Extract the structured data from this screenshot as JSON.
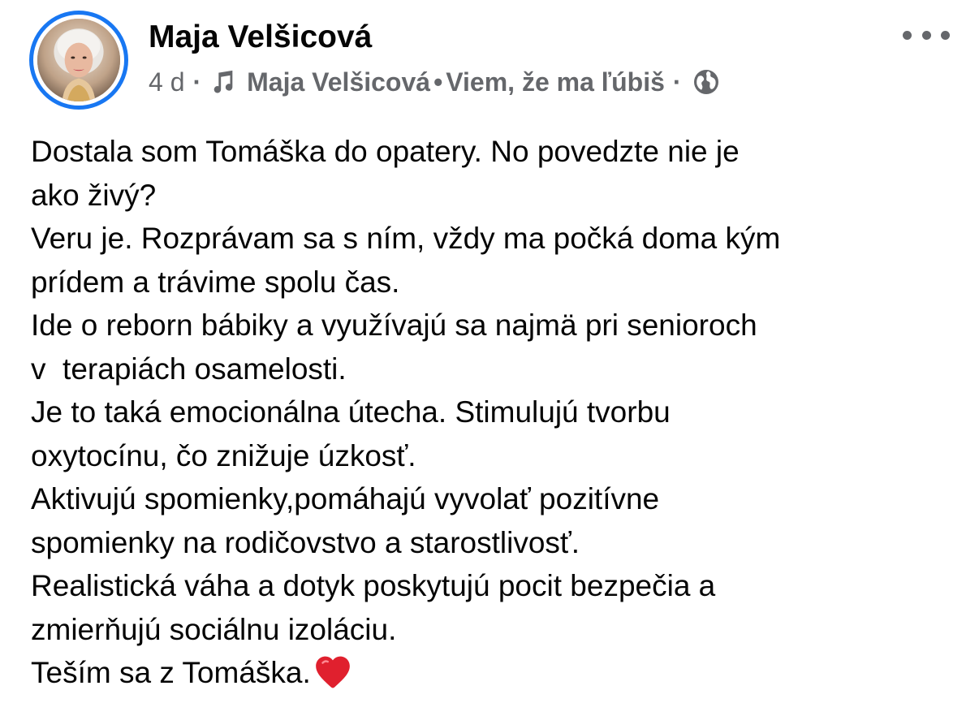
{
  "post": {
    "author": "Maja Velšicová",
    "time": "4 d",
    "separator": "·",
    "song_artist": "Maja Velšicová",
    "song_separator": "•",
    "song_title": "Viem, že ma ľúbiš",
    "audience_icon": "globe-icon",
    "music_icon": "music-note-icon",
    "menu_icon": "more-options-icon",
    "lines": [
      "Dostala som Tomáška do opatery. No povedzte nie je",
      "ako živý?",
      "Veru je. Rozprávam sa s ním, vždy ma počká doma kým",
      "prídem a trávime spolu čas.",
      "Ide o reborn bábiky a využívajú sa najmä pri senioroch",
      "v  terapiách osamelosti.",
      "Je to taká emocionálna útecha. Stimulujú tvorbu",
      "oxytocínu, čo znižuje úzkosť.",
      "Aktivujú spomienky,pomáhajú vyvolať pozitívne",
      "spomienky na rodičovstvo a starostlivosť.",
      "Realistická váha a dotyk poskytujú pocit bezpečia a",
      "zmierňujú sociálnu izoláciu.",
      "Teším sa z Tomáška."
    ],
    "end_emoji": "red-heart-icon"
  },
  "colors": {
    "story_ring": "#1877f2",
    "text_primary": "#050505",
    "text_secondary": "#65676b",
    "heart": "#e0202e"
  }
}
